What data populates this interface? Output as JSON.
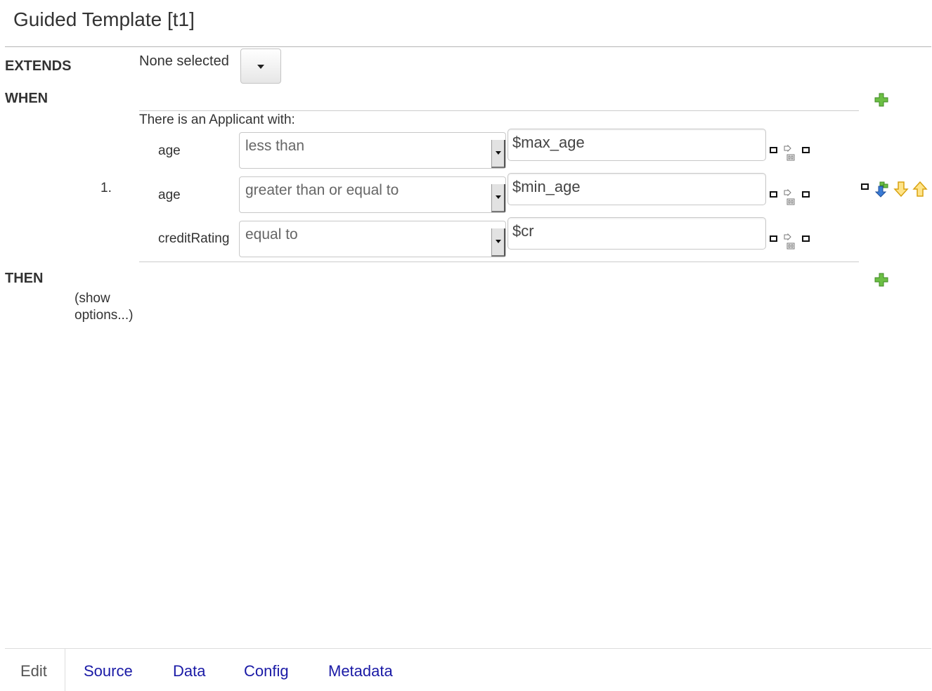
{
  "title": "Guided Template [t1]",
  "extends": {
    "label": "EXTENDS",
    "selected": "None selected"
  },
  "when": {
    "label": "WHEN",
    "pattern_header": "There is an Applicant with:",
    "row_number": "1.",
    "constraints": [
      {
        "field": "age",
        "operator": "less than",
        "value": "$max_age"
      },
      {
        "field": "age",
        "operator": "greater than or equal to",
        "value": "$min_age"
      },
      {
        "field": "creditRating",
        "operator": "equal to",
        "value": "$cr"
      }
    ]
  },
  "then": {
    "label": "THEN",
    "show_options": "(show options...)"
  },
  "tabs": {
    "edit": "Edit",
    "source": "Source",
    "data": "Data",
    "config": "Config",
    "metadata": "Metadata"
  },
  "colors": {
    "tab_link": "#1a1aa6",
    "plus_green": "#5fb13d",
    "arrow_yellow": "#e8b21b",
    "rule_gray": "#cccccc"
  },
  "icons": [
    "chevron-down-icon",
    "add-condition-icon",
    "add-action-icon",
    "remove-icon",
    "connect-icon",
    "insert-below-icon",
    "move-down-icon",
    "move-up-icon"
  ]
}
